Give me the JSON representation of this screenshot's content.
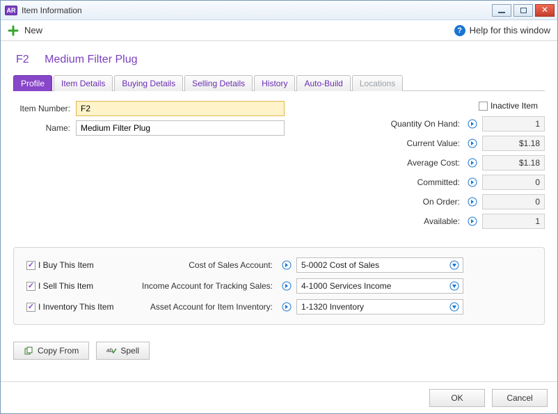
{
  "window": {
    "app_badge": "AR",
    "title": "Item Information"
  },
  "toolbar": {
    "new_label": "New",
    "help_label": "Help for this window"
  },
  "item": {
    "code": "F2",
    "name": "Medium Filter Plug"
  },
  "tabs": [
    {
      "label": "Profile",
      "active": true,
      "disabled": false
    },
    {
      "label": "Item Details",
      "active": false,
      "disabled": false
    },
    {
      "label": "Buying Details",
      "active": false,
      "disabled": false
    },
    {
      "label": "Selling Details",
      "active": false,
      "disabled": false
    },
    {
      "label": "History",
      "active": false,
      "disabled": false
    },
    {
      "label": "Auto-Build",
      "active": false,
      "disabled": false
    },
    {
      "label": "Locations",
      "active": false,
      "disabled": true
    }
  ],
  "form": {
    "item_number_label": "Item Number:",
    "item_number_value": "F2",
    "name_label": "Name:",
    "name_value": "Medium Filter Plug",
    "inactive_label": "Inactive Item",
    "inactive_checked": false
  },
  "stats": [
    {
      "label": "Quantity On Hand:",
      "value": "1"
    },
    {
      "label": "Current Value:",
      "value": "$1.18"
    },
    {
      "label": "Average Cost:",
      "value": "$1.18"
    },
    {
      "label": "Committed:",
      "value": "0"
    },
    {
      "label": "On Order:",
      "value": "0"
    },
    {
      "label": "Available:",
      "value": "1"
    }
  ],
  "panel": {
    "buy_label": "I Buy This Item",
    "sell_label": "I Sell This Item",
    "inventory_label": "I Inventory This Item",
    "cos_label": "Cost of Sales Account:",
    "cos_value": "5-0002 Cost of Sales",
    "income_label": "Income Account for Tracking Sales:",
    "income_value": "4-1000 Services Income",
    "asset_label": "Asset Account for Item Inventory:",
    "asset_value": "1-1320 Inventory"
  },
  "buttons": {
    "copy_from": "Copy From",
    "spell": "Spell",
    "ok": "OK",
    "cancel": "Cancel"
  }
}
